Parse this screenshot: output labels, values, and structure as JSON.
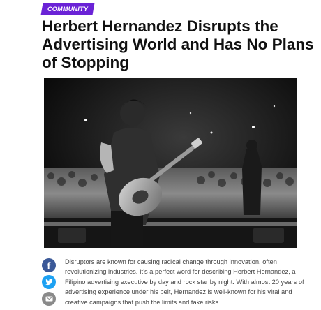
{
  "article": {
    "category": "COMMUNITY",
    "title": "Herbert Hernandez Disrupts the Advertising World and Has No Plans of Stopping",
    "body": "Disruptors are known for causing radical change through innovation, often revolutionizing industries. It’s a perfect word for describing Herbert Hernandez, a Filipino advertising executive by day and rock star by night. With almost 20 years of advertising experience under his belt, Hernandez is well-known for his viral and creative campaigns that push the limits and take risks."
  },
  "share": {
    "items": [
      {
        "icon": "facebook-icon",
        "color": "#3b5998"
      },
      {
        "icon": "twitter-icon",
        "color": "#1da1f2"
      },
      {
        "icon": "email-icon",
        "color": "#8a8a8a"
      }
    ]
  },
  "colors": {
    "badge": "#6a22d6",
    "headline": "#111111",
    "body_text": "#444444"
  }
}
